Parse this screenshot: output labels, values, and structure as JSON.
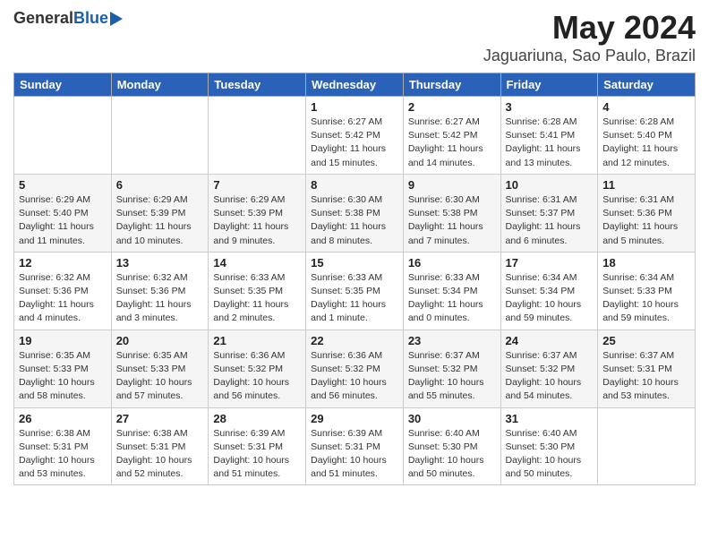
{
  "header": {
    "logo_general": "General",
    "logo_blue": "Blue",
    "month_title": "May 2024",
    "location": "Jaguariuna, Sao Paulo, Brazil"
  },
  "weekdays": [
    "Sunday",
    "Monday",
    "Tuesday",
    "Wednesday",
    "Thursday",
    "Friday",
    "Saturday"
  ],
  "weeks": [
    [
      {
        "day": "",
        "info": ""
      },
      {
        "day": "",
        "info": ""
      },
      {
        "day": "",
        "info": ""
      },
      {
        "day": "1",
        "info": "Sunrise: 6:27 AM\nSunset: 5:42 PM\nDaylight: 11 hours\nand 15 minutes."
      },
      {
        "day": "2",
        "info": "Sunrise: 6:27 AM\nSunset: 5:42 PM\nDaylight: 11 hours\nand 14 minutes."
      },
      {
        "day": "3",
        "info": "Sunrise: 6:28 AM\nSunset: 5:41 PM\nDaylight: 11 hours\nand 13 minutes."
      },
      {
        "day": "4",
        "info": "Sunrise: 6:28 AM\nSunset: 5:40 PM\nDaylight: 11 hours\nand 12 minutes."
      }
    ],
    [
      {
        "day": "5",
        "info": "Sunrise: 6:29 AM\nSunset: 5:40 PM\nDaylight: 11 hours\nand 11 minutes."
      },
      {
        "day": "6",
        "info": "Sunrise: 6:29 AM\nSunset: 5:39 PM\nDaylight: 11 hours\nand 10 minutes."
      },
      {
        "day": "7",
        "info": "Sunrise: 6:29 AM\nSunset: 5:39 PM\nDaylight: 11 hours\nand 9 minutes."
      },
      {
        "day": "8",
        "info": "Sunrise: 6:30 AM\nSunset: 5:38 PM\nDaylight: 11 hours\nand 8 minutes."
      },
      {
        "day": "9",
        "info": "Sunrise: 6:30 AM\nSunset: 5:38 PM\nDaylight: 11 hours\nand 7 minutes."
      },
      {
        "day": "10",
        "info": "Sunrise: 6:31 AM\nSunset: 5:37 PM\nDaylight: 11 hours\nand 6 minutes."
      },
      {
        "day": "11",
        "info": "Sunrise: 6:31 AM\nSunset: 5:36 PM\nDaylight: 11 hours\nand 5 minutes."
      }
    ],
    [
      {
        "day": "12",
        "info": "Sunrise: 6:32 AM\nSunset: 5:36 PM\nDaylight: 11 hours\nand 4 minutes."
      },
      {
        "day": "13",
        "info": "Sunrise: 6:32 AM\nSunset: 5:36 PM\nDaylight: 11 hours\nand 3 minutes."
      },
      {
        "day": "14",
        "info": "Sunrise: 6:33 AM\nSunset: 5:35 PM\nDaylight: 11 hours\nand 2 minutes."
      },
      {
        "day": "15",
        "info": "Sunrise: 6:33 AM\nSunset: 5:35 PM\nDaylight: 11 hours\nand 1 minute."
      },
      {
        "day": "16",
        "info": "Sunrise: 6:33 AM\nSunset: 5:34 PM\nDaylight: 11 hours\nand 0 minutes."
      },
      {
        "day": "17",
        "info": "Sunrise: 6:34 AM\nSunset: 5:34 PM\nDaylight: 10 hours\nand 59 minutes."
      },
      {
        "day": "18",
        "info": "Sunrise: 6:34 AM\nSunset: 5:33 PM\nDaylight: 10 hours\nand 59 minutes."
      }
    ],
    [
      {
        "day": "19",
        "info": "Sunrise: 6:35 AM\nSunset: 5:33 PM\nDaylight: 10 hours\nand 58 minutes."
      },
      {
        "day": "20",
        "info": "Sunrise: 6:35 AM\nSunset: 5:33 PM\nDaylight: 10 hours\nand 57 minutes."
      },
      {
        "day": "21",
        "info": "Sunrise: 6:36 AM\nSunset: 5:32 PM\nDaylight: 10 hours\nand 56 minutes."
      },
      {
        "day": "22",
        "info": "Sunrise: 6:36 AM\nSunset: 5:32 PM\nDaylight: 10 hours\nand 56 minutes."
      },
      {
        "day": "23",
        "info": "Sunrise: 6:37 AM\nSunset: 5:32 PM\nDaylight: 10 hours\nand 55 minutes."
      },
      {
        "day": "24",
        "info": "Sunrise: 6:37 AM\nSunset: 5:32 PM\nDaylight: 10 hours\nand 54 minutes."
      },
      {
        "day": "25",
        "info": "Sunrise: 6:37 AM\nSunset: 5:31 PM\nDaylight: 10 hours\nand 53 minutes."
      }
    ],
    [
      {
        "day": "26",
        "info": "Sunrise: 6:38 AM\nSunset: 5:31 PM\nDaylight: 10 hours\nand 53 minutes."
      },
      {
        "day": "27",
        "info": "Sunrise: 6:38 AM\nSunset: 5:31 PM\nDaylight: 10 hours\nand 52 minutes."
      },
      {
        "day": "28",
        "info": "Sunrise: 6:39 AM\nSunset: 5:31 PM\nDaylight: 10 hours\nand 51 minutes."
      },
      {
        "day": "29",
        "info": "Sunrise: 6:39 AM\nSunset: 5:31 PM\nDaylight: 10 hours\nand 51 minutes."
      },
      {
        "day": "30",
        "info": "Sunrise: 6:40 AM\nSunset: 5:30 PM\nDaylight: 10 hours\nand 50 minutes."
      },
      {
        "day": "31",
        "info": "Sunrise: 6:40 AM\nSunset: 5:30 PM\nDaylight: 10 hours\nand 50 minutes."
      },
      {
        "day": "",
        "info": ""
      }
    ]
  ]
}
